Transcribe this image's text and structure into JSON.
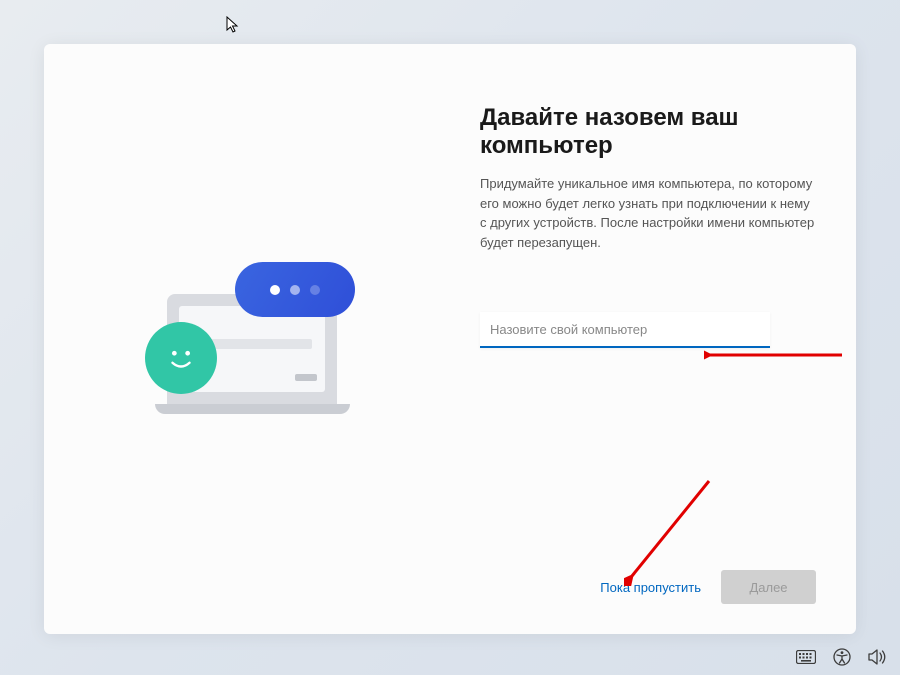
{
  "content": {
    "title": "Давайте назовем ваш компьютер",
    "description": "Придумайте уникальное имя компьютера, по которому его можно будет легко узнать при подключении к нему с других устройств. После настройки имени компьютер будет перезапущен.",
    "input_placeholder": "Назовите свой компьютер",
    "input_value": "",
    "skip_label": "Пока пропустить",
    "next_label": "Далее"
  },
  "colors": {
    "accent": "#0067c0",
    "bubble_start": "#3a65e0",
    "bubble_end": "#2f4fd8",
    "smiley": "#31c6a6"
  }
}
